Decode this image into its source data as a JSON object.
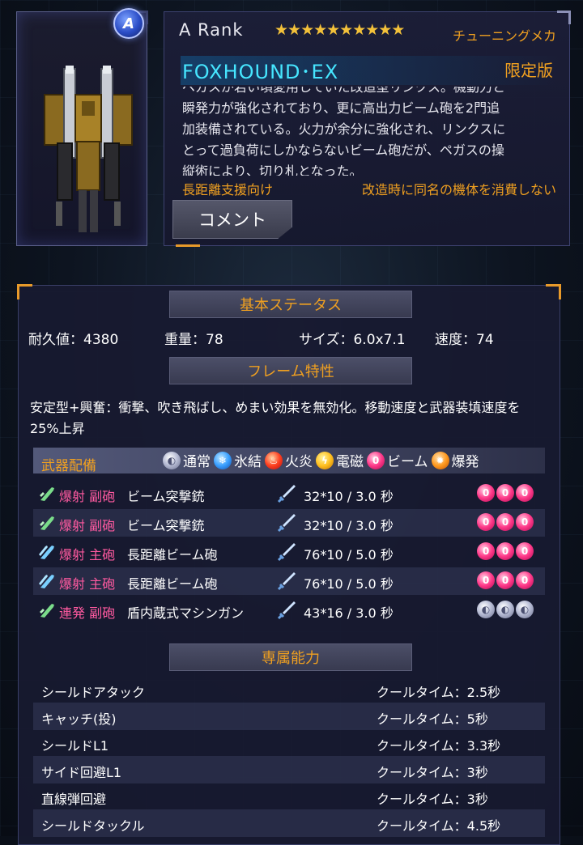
{
  "unit": {
    "rank_badge": "A",
    "rank": "A  Rank",
    "stars": "★★★★★★★★★★",
    "category": "チューニングメカ",
    "name": "FOXHOUND･EX",
    "limited": "限定版",
    "description": [
      "ペガスが若い頃愛用していた改造型リンクス。機動力と",
      "瞬発力が強化されており、更に高出力ビーム砲を2門追",
      "加装備されている。火力が余分に強化され、リンクスに",
      "とって過負荷にしかならないビーム砲だが、ペガスの操",
      "縦術により、切り札となった。"
    ],
    "role_tag": "長距離支援向け",
    "upgrade_tag": "改造時に同名の機体を消費しない",
    "comment_button": "コメント"
  },
  "basic_status": {
    "header": "基本ステータス",
    "durability": "耐久値：4380",
    "weight": "重量：78",
    "size": "サイズ：6.0x7.1",
    "speed": "速度：74"
  },
  "frame": {
    "header": "フレーム特性",
    "text": "安定型+興奮：衝撃、吹き飛ばし、めまい効果を無効化。移動速度と武器装填速度を25%上昇"
  },
  "weapons": {
    "header": "武器配備",
    "legend": [
      {
        "icon": "normal-element-icon",
        "label": "通常",
        "cls": "e-normal",
        "glyph": "◐"
      },
      {
        "icon": "ice-element-icon",
        "label": "氷結",
        "cls": "e-ice",
        "glyph": "❄"
      },
      {
        "icon": "fire-element-icon",
        "label": "火炎",
        "cls": "e-fire",
        "glyph": "♨"
      },
      {
        "icon": "electric-element-icon",
        "label": "電磁",
        "cls": "e-elec",
        "glyph": "ϟ"
      },
      {
        "icon": "beam-element-icon",
        "label": "ビーム",
        "cls": "e-beam",
        "glyph": "0"
      },
      {
        "icon": "blast-element-icon",
        "label": "爆発",
        "cls": "e-blast",
        "glyph": "✹"
      }
    ],
    "rows": [
      {
        "type": "爆射 副砲",
        "name": "ビーム突撃銃",
        "damage": "32*10  / 3.0 秒",
        "mount_icon": "single-gun-icon",
        "element": "beam",
        "count": 3
      },
      {
        "type": "爆射 副砲",
        "name": "ビーム突撃銃",
        "damage": "32*10  / 3.0 秒",
        "mount_icon": "single-gun-icon",
        "element": "beam",
        "count": 3
      },
      {
        "type": "爆射 主砲",
        "name": "長距離ビーム砲",
        "damage": "76*10  / 5.0 秒",
        "mount_icon": "double-gun-icon",
        "element": "beam",
        "count": 3
      },
      {
        "type": "爆射 主砲",
        "name": "長距離ビーム砲",
        "damage": "76*10  / 5.0 秒",
        "mount_icon": "double-gun-icon",
        "element": "beam",
        "count": 3
      },
      {
        "type": "連発 副砲",
        "name": "盾内蔵式マシンガン",
        "damage": "43*16  / 3.0 秒",
        "mount_icon": "single-gun-icon",
        "element": "normal",
        "count": 3
      }
    ]
  },
  "abilities": {
    "header": "専属能力",
    "rows": [
      {
        "name": "シールドアタック",
        "cooldown": "クールタイム：2.5秒"
      },
      {
        "name": "キャッチ(投)",
        "cooldown": "クールタイム：5秒"
      },
      {
        "name": "シールドL1",
        "cooldown": "クールタイム：3.3秒"
      },
      {
        "name": "サイド回避L1",
        "cooldown": "クールタイム：3秒"
      },
      {
        "name": "直線弾回避",
        "cooldown": "クールタイム：3秒"
      },
      {
        "name": "シールドタックル",
        "cooldown": "クールタイム：4.5秒"
      }
    ]
  },
  "colors": {
    "accent": "#f0a020",
    "name": "#46e6ff",
    "weapon_type": "#ff5aa0"
  }
}
